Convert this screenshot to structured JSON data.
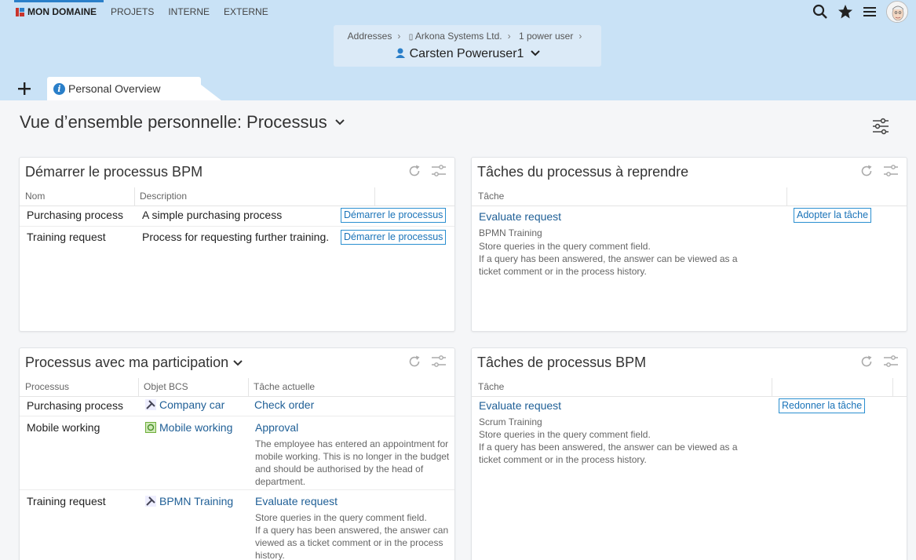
{
  "nav": {
    "items": [
      "MON DOMAINE",
      "PROJETS",
      "INTERNE",
      "EXTERNE"
    ]
  },
  "breadcrumb": {
    "items": [
      "Addresses",
      "Arkona Systems Ltd.",
      "1 power user"
    ],
    "user": "Carsten Poweruser1"
  },
  "tabs": {
    "active_label": "Personal Overview"
  },
  "page": {
    "title": "Vue d’ensemble personnelle: Processus"
  },
  "panel_start": {
    "title": "Démarrer le processus BPM",
    "headers": [
      "Nom",
      "Description"
    ],
    "rows": [
      {
        "name": "Purchasing process",
        "description": "A simple purchasing process",
        "action": "Démarrer le processus"
      },
      {
        "name": "Training request",
        "description": "Process for requesting further training.",
        "action": "Démarrer le processus"
      }
    ]
  },
  "panel_resume": {
    "title": "Tâches du processus à reprendre",
    "headers": [
      "Tâche"
    ],
    "task": "Evaluate request",
    "subtitle": "BPMN Training",
    "lines": [
      "Store queries in the query comment field.",
      "If a query has been answered, the answer can be viewed as a",
      "ticket comment or in the process history."
    ],
    "action": "Adopter la tâche"
  },
  "panel_participation": {
    "title": "Processus avec ma participation",
    "headers": [
      "Processus",
      "Objet BCS",
      "Tâche actuelle"
    ],
    "rows": [
      {
        "process": "Purchasing process",
        "object": "Company car",
        "task": "Check order",
        "lines": []
      },
      {
        "process": "Mobile working",
        "object": "Mobile working",
        "task": "Approval",
        "lines": [
          "The employee has entered an appointment for",
          "mobile working. This is no longer in the budget",
          "and should be authorised by the head of",
          "department."
        ]
      },
      {
        "process": "Training request",
        "object": "BPMN Training",
        "task": "Evaluate request",
        "lines": [
          "Store queries in the query comment field.",
          "If a query has been answered, the answer can",
          "viewed as a ticket comment or in the process",
          "history."
        ]
      }
    ]
  },
  "panel_bpm_tasks": {
    "title": "Tâches de processus BPM",
    "headers": [
      "Tâche"
    ],
    "task": "Evaluate request",
    "subtitle": "Scrum Training",
    "lines": [
      "Store queries in the query comment field.",
      "If a query has been answered, the answer can be viewed as a",
      "ticket comment or in the process history."
    ],
    "action": "Redonner la tâche"
  },
  "colors": {
    "header_bg": "#c9e2f6",
    "accent": "#2a7fc9",
    "link": "#1f5f96"
  }
}
